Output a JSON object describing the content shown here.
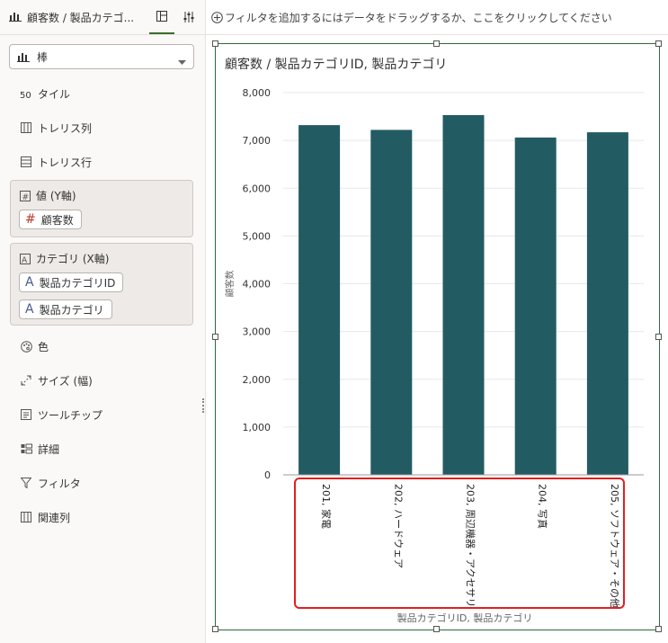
{
  "header": {
    "viz_name": "顧客数 / 製品カテゴ..."
  },
  "filter_bar": {
    "placeholder": "フィルタを追加するにはデータをドラッグするか、ここをクリックしてください"
  },
  "chart_type": {
    "selected": "棒"
  },
  "properties": {
    "tile": "タイル",
    "trellis_columns": "トレリス列",
    "trellis_rows": "トレリス行",
    "values_well": {
      "title": "値 (Y軸)",
      "items": [
        "顧客数"
      ]
    },
    "category_well": {
      "title": "カテゴリ (X軸)",
      "items": [
        "製品カテゴリID",
        "製品カテゴリ"
      ]
    },
    "color": "色",
    "size": "サイズ (幅)",
    "tooltip": "ツールチップ",
    "detail": "詳細",
    "filter": "フィルタ",
    "related_columns": "関連列"
  },
  "colors": {
    "bar": "#235b63",
    "accent": "#3a6d2a",
    "highlight": "#e02020"
  },
  "chart_data": {
    "type": "bar",
    "title": "顧客数 / 製品カテゴリID, 製品カテゴリ",
    "xlabel": "製品カテゴリID, 製品カテゴリ",
    "ylabel": "顧客数",
    "ylim": [
      0,
      8000
    ],
    "yticks": [
      "0",
      "1,000",
      "2,000",
      "3,000",
      "4,000",
      "5,000",
      "6,000",
      "7,000",
      "8,000"
    ],
    "categories": [
      "201, 家電",
      "202, ハードウェア",
      "203, 周辺機器・アクセサリ",
      "204, 写真",
      "205, ソフトウェア・その他"
    ],
    "values": [
      7320,
      7220,
      7530,
      7060,
      7170
    ],
    "grid": true
  }
}
